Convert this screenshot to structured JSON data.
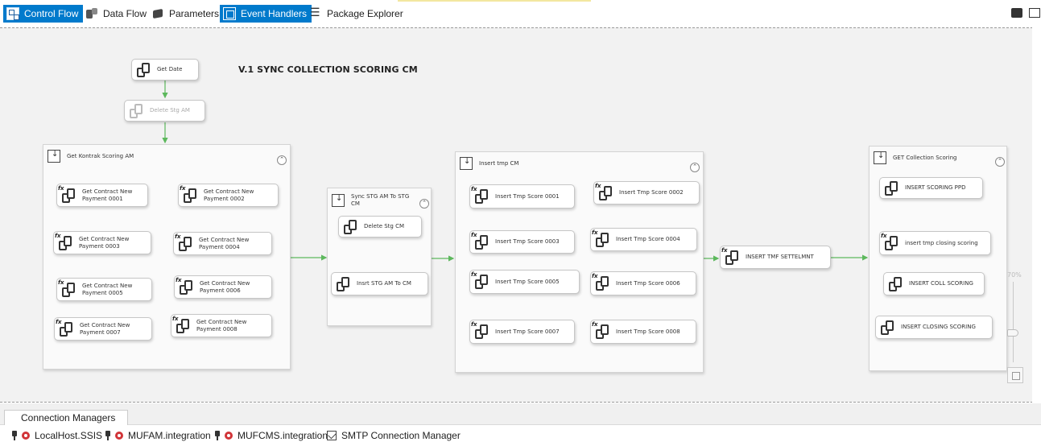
{
  "tabs": [
    {
      "label": "Control Flow",
      "icon": "control-flow-icon",
      "active": true
    },
    {
      "label": "Data Flow",
      "icon": "data-flow-icon",
      "active": false
    },
    {
      "label": "Parameters",
      "icon": "parameters-icon",
      "active": false
    },
    {
      "label": "Event Handlers",
      "icon": "event-handlers-icon",
      "active": true
    },
    {
      "label": "Package Explorer",
      "icon": "package-explorer-icon",
      "active": false
    }
  ],
  "package_title": "V.1 SYNC COLLECTION SCORING CM",
  "tasks": {
    "get_date": "Get Date",
    "delete_stg_am": "Delete Stg AM",
    "insert_tmf_settelmnt": "INSERT TMF SETTELMNT"
  },
  "containers": {
    "kontrak": {
      "title": "Get Kontrak Scoring AM",
      "tasks": [
        "Get Contract New Payment 0001",
        "Get Contract New Payment 0002",
        "Get Contract New Payment 0003",
        "Get Contract New Payment 0004",
        "Get Contract New Payment 0005",
        "Get Contract New Payment 0006",
        "Get Contract New Payment 0007",
        "Get Contract New Payment 0008"
      ]
    },
    "sync": {
      "title": "Sync STG AM To STG CM",
      "tasks": [
        "Delete Stg CM",
        "Insrt STG AM To CM"
      ]
    },
    "insert_tmp": {
      "title": "Insert tmp CM",
      "tasks": [
        "Insert Tmp Score 0001",
        "Insert Tmp Score 0002",
        "Insert Tmp Score 0003",
        "Insert Tmp Score 0004",
        "Insert Tmp Score 0005",
        "Insert Tmp Score 0006",
        "Insert Tmp Score 0007",
        "Insert Tmp Score 0008"
      ]
    },
    "collection": {
      "title": "GET Collection Scoring",
      "tasks": [
        "INSERT SCORING PPD",
        "insert tmp closing scoring",
        "INSERT COLL SCORING",
        "INSERT CLOSING SCORING"
      ]
    }
  },
  "collapse_glyph": "⌃",
  "zoom": {
    "label": "70%",
    "value": 70
  },
  "connection_managers": {
    "tab_label": "Connection Managers",
    "items": [
      {
        "label": "LocalHost.SSIS",
        "icon": "plug-icon",
        "error": true
      },
      {
        "label": "MUFAM.integration",
        "icon": "plug-icon",
        "error": true
      },
      {
        "label": "MUFCMS.integration",
        "icon": "plug-icon",
        "error": true
      },
      {
        "label": "SMTP Connection Manager",
        "icon": "smtp-icon",
        "error": false
      }
    ]
  },
  "colors": {
    "accent": "#007acc",
    "precedence": "#5cb85c",
    "error": "#d13438",
    "canvas": "#f2f2f2"
  }
}
